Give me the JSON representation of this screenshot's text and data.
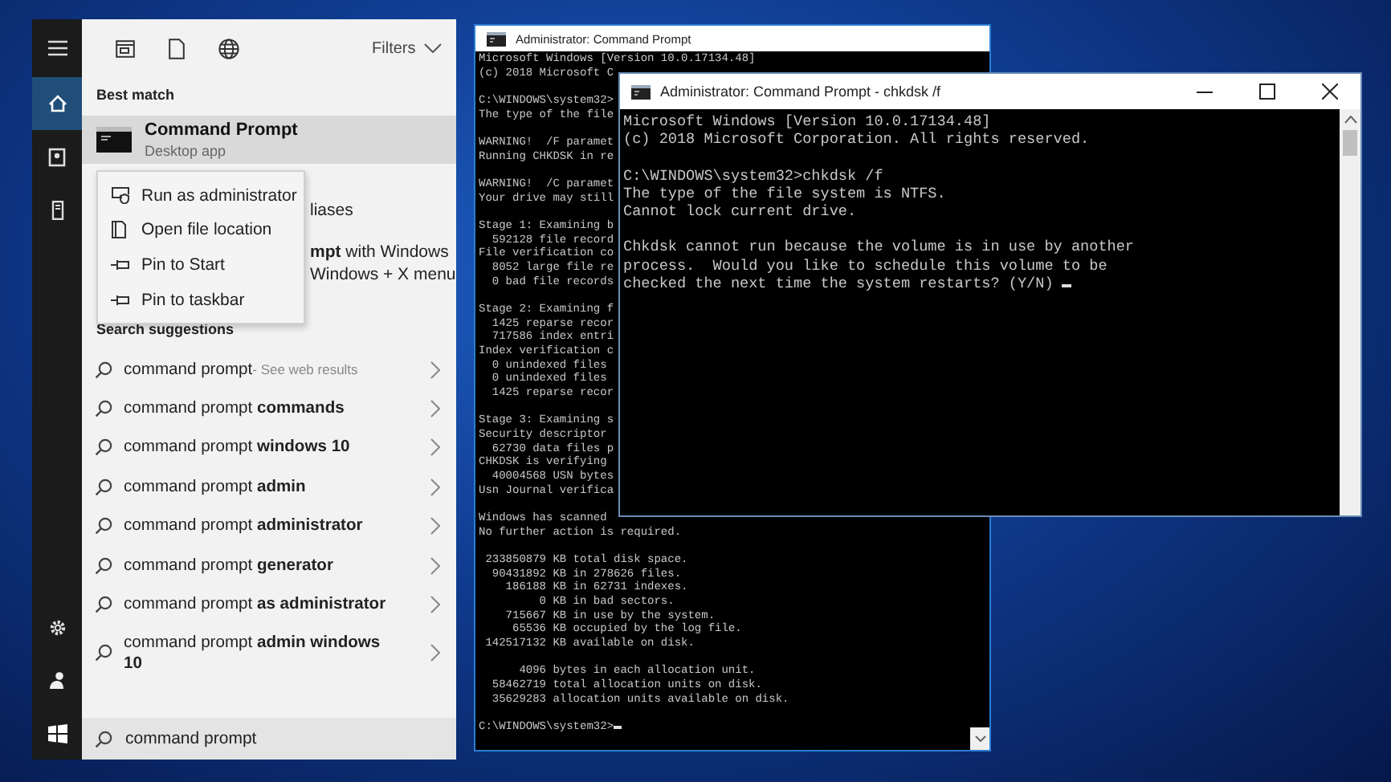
{
  "start_menu": {
    "sidebar_top": [
      {
        "kind": "menu",
        "selected": false
      },
      {
        "kind": "home",
        "selected": true
      },
      {
        "kind": "notebook",
        "selected": false
      },
      {
        "kind": "device",
        "selected": false
      }
    ],
    "sidebar_bottom": [
      {
        "kind": "settings"
      },
      {
        "kind": "person"
      },
      {
        "kind": "windows"
      }
    ],
    "toolbar": [
      {
        "kind": "apps"
      },
      {
        "kind": "documents"
      },
      {
        "kind": "web"
      }
    ],
    "filters": "Filters",
    "best_match": {
      "heading": "Best match",
      "title": "Command Prompt",
      "subtitle": "Desktop app",
      "selected": true
    },
    "other_results": [
      [
        "liases"
      ],
      [
        "**mpt** with Windows",
        "Windows + X menu"
      ]
    ],
    "context_menu": [
      {
        "kind": "admin",
        "label": "Run as administrator"
      },
      {
        "kind": "folder",
        "label": "Open file location"
      },
      {
        "kind": "pin",
        "label": "Pin to Start"
      },
      {
        "kind": "pin",
        "label": "Pin to taskbar"
      }
    ],
    "suggestions_heading": "Search suggestions",
    "suggestions": [
      {
        "text": "command prompt",
        "note": "- See web results"
      },
      {
        "text": "command prompt **commands**"
      },
      {
        "text": "command prompt **windows 10**"
      },
      {
        "text": "command prompt **admin**"
      },
      {
        "text": "command prompt **administrator**"
      },
      {
        "text": "command prompt **generator**"
      },
      {
        "text": "command prompt **as administrator**"
      },
      {
        "text": "command prompt **admin windows 10**"
      }
    ],
    "search": {
      "value": "command prompt"
    }
  },
  "back_window": {
    "title": "Administrator: Command Prompt",
    "blocks": [
      [
        "Microsoft Windows [Version 10.0.17134.48]",
        "(c) 2018 Microsoft C"
      ],
      [
        "C:\\WINDOWS\\system32>",
        "The type of the file"
      ],
      [
        "WARNING!  /F paramet",
        "Running CHKDSK in re"
      ],
      [
        "WARNING!  /C paramet",
        "Your drive may still"
      ],
      [
        "Stage 1: Examining b",
        "  592128 file record",
        "File verification co",
        "  8052 large file re",
        "  0 bad file records"
      ],
      [
        "Stage 2: Examining f",
        "  1425 reparse recor",
        "  717586 index entri",
        "Index verification c",
        "  0 unindexed files",
        "  0 unindexed files",
        "  1425 reparse recor"
      ],
      [
        "Stage 3: Examining s",
        "Security descriptor",
        "  62730 data files p",
        "CHKDSK is verifying",
        "  40004568 USN bytes",
        "Usn Journal verifica"
      ],
      [
        "Windows has scanned",
        "No further action is required."
      ],
      [
        " 233850879 KB total disk space.",
        "  90431892 KB in 278626 files.",
        "    186188 KB in 62731 indexes.",
        "         0 KB in bad sectors.",
        "    715667 KB in use by the system.",
        "     65536 KB occupied by the log file.",
        " 142517132 KB available on disk."
      ],
      [
        "      4096 bytes in each allocation unit.",
        "  58462719 total allocation units on disk.",
        "  35629283 allocation units available on disk."
      ],
      [
        "C:\\WINDOWS\\system32>"
      ]
    ],
    "cursor": true
  },
  "front_window": {
    "title": "Administrator: Command Prompt - chkdsk  /f",
    "blocks": [
      [
        "Microsoft Windows [Version 10.0.17134.48]",
        "(c) 2018 Microsoft Corporation. All rights reserved."
      ],
      [
        "C:\\WINDOWS\\system32>chkdsk /f",
        "The type of the file system is NTFS.",
        "Cannot lock current drive."
      ],
      [
        "Chkdsk cannot run because the volume is in use by another",
        "process.  Would you like to schedule this volume to be",
        "checked the next time the system restarts? (Y/N) "
      ]
    ],
    "cursor": true
  }
}
